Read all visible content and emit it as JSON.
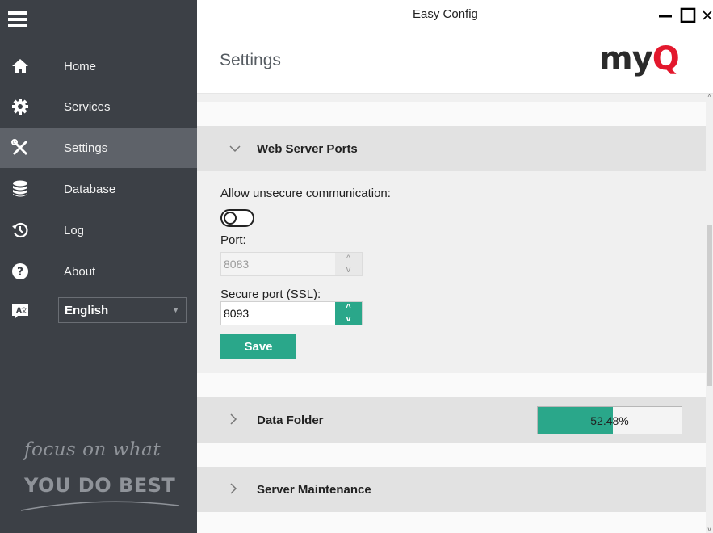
{
  "window": {
    "title": "Easy Config",
    "minimize_glyph": "—",
    "maximize_glyph": "☐",
    "close_glyph": "✕"
  },
  "sidebar": {
    "items": [
      {
        "label": "Home",
        "icon": "home-icon"
      },
      {
        "label": "Services",
        "icon": "gear-icon"
      },
      {
        "label": "Settings",
        "icon": "wrench-screwdriver-icon",
        "active": true
      },
      {
        "label": "Database",
        "icon": "database-icon"
      },
      {
        "label": "Log",
        "icon": "history-icon"
      },
      {
        "label": "About",
        "icon": "question-icon"
      }
    ],
    "language": {
      "icon": "translate-icon",
      "selected": "English"
    },
    "tagline_line1": "focus on what",
    "tagline_line2": "YOU DO BEST"
  },
  "header": {
    "page_title": "Settings",
    "logo_my": "my",
    "logo_q": "Q"
  },
  "sections": {
    "web_server_ports": {
      "title": "Web Server Ports",
      "expanded": true,
      "allow_unsecure_label": "Allow unsecure communication:",
      "allow_unsecure_on": false,
      "port_label": "Port:",
      "port_value": "8083",
      "secure_port_label": "Secure port (SSL):",
      "secure_port_value": "8093",
      "spin_up": "^",
      "spin_down": "v",
      "save_label": "Save"
    },
    "data_folder": {
      "title": "Data Folder",
      "progress_text": "52.48%",
      "progress_fraction": 0.5248
    },
    "server_maintenance": {
      "title": "Server Maintenance"
    }
  },
  "colors": {
    "sidebar_bg": "#3c4046",
    "sidebar_active": "#5e6269",
    "accent": "#2aa78a",
    "logo_red": "#e3182d"
  }
}
